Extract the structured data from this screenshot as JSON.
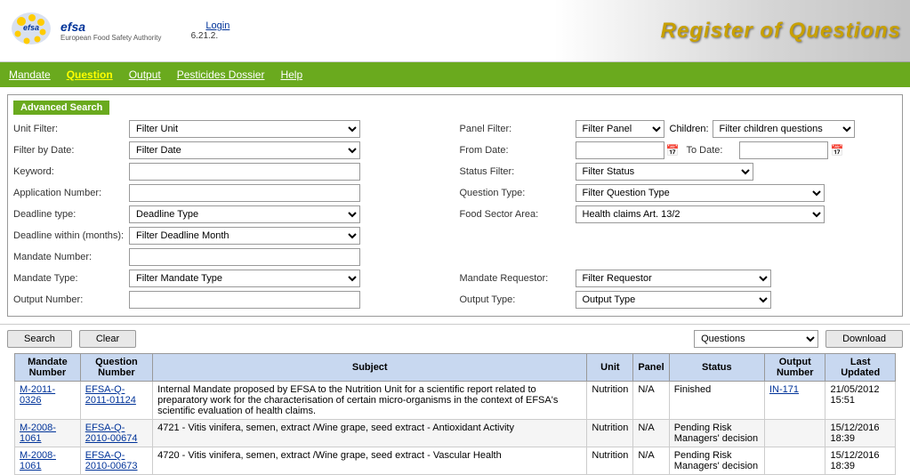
{
  "header": {
    "logo_text": "efsa",
    "logo_sub": "European Food Safety Authority",
    "login_label": "Login",
    "version": "6.21.2.",
    "title": "Register of Questions"
  },
  "navbar": {
    "items": [
      {
        "label": "Mandate",
        "active": false
      },
      {
        "label": "Question",
        "active": true
      },
      {
        "label": "Output",
        "active": false
      },
      {
        "label": "Pesticides Dossier",
        "active": false
      },
      {
        "label": "Help",
        "active": false
      }
    ]
  },
  "search": {
    "advanced_label": "Advanced Search",
    "unit_filter_label": "Unit Filter:",
    "unit_filter_value": "Filter Unit",
    "panel_filter_label": "Panel Filter:",
    "panel_filter_value": "Filter Panel",
    "children_label": "Children:",
    "children_value": "Filter children questions",
    "filter_by_date_label": "Filter by Date:",
    "filter_by_date_value": "Filter Date",
    "from_date_label": "From Date:",
    "from_date_value": "",
    "to_date_label": "To Date:",
    "to_date_value": "",
    "keyword_label": "Keyword:",
    "keyword_value": "",
    "status_filter_label": "Status Filter:",
    "status_filter_value": "Filter Status",
    "app_number_label": "Application Number:",
    "app_number_value": "",
    "question_type_label": "Question Type:",
    "question_type_value": "Filter Question Type",
    "deadline_type_label": "Deadline type:",
    "deadline_type_value": "Deadline Type",
    "food_sector_label": "Food Sector Area:",
    "food_sector_value": "Health claims Art. 13/2",
    "deadline_within_label": "Deadline within (months):",
    "deadline_within_value": "Filter Deadline Month",
    "mandate_number_label": "Mandate Number:",
    "mandate_number_value": "",
    "mandate_type_label": "Mandate Type:",
    "mandate_type_value": "Filter Mandate Type",
    "mandate_requestor_label": "Mandate Requestor:",
    "mandate_requestor_value": "Filter Requestor",
    "output_number_label": "Output Number:",
    "output_number_value": "",
    "output_type_label": "Output Type:",
    "output_type_value": "Output Type",
    "search_btn": "Search",
    "clear_btn": "Clear",
    "results_type_value": "Questions",
    "download_btn": "Download"
  },
  "table": {
    "headers": [
      "Mandate Number",
      "Question Number",
      "Subject",
      "Unit",
      "Panel",
      "Status",
      "Output Number",
      "Last Updated"
    ],
    "rows": [
      {
        "mandate_number": "M-2011-0326",
        "question_number": "EFSA-Q-2011-01124",
        "subject": "Internal Mandate proposed by EFSA to the Nutrition Unit for a scientific report related to preparatory work for the characterisation of certain micro-organisms in the context of EFSA's scientific evaluation of health claims.",
        "unit": "Nutrition",
        "panel": "N/A",
        "status": "Finished",
        "output_number": "IN-171",
        "last_updated": "21/05/2012 15:51"
      },
      {
        "mandate_number": "M-2008-1061",
        "question_number": "EFSA-Q-2010-00674",
        "subject": "4721 - Vitis vinifera, semen, extract /Wine grape, seed extract - Antioxidant Activity",
        "unit": "Nutrition",
        "panel": "N/A",
        "status": "Pending Risk Managers' decision",
        "output_number": "",
        "last_updated": "15/12/2016 18:39"
      },
      {
        "mandate_number": "M-2008-1061",
        "question_number": "EFSA-Q-2010-00673",
        "subject": "4720 - Vitis vinifera, semen, extract /Wine grape, seed extract - Vascular Health",
        "unit": "Nutrition",
        "panel": "N/A",
        "status": "Pending Risk Managers' decision",
        "output_number": "",
        "last_updated": "15/12/2016 18:39"
      }
    ]
  }
}
